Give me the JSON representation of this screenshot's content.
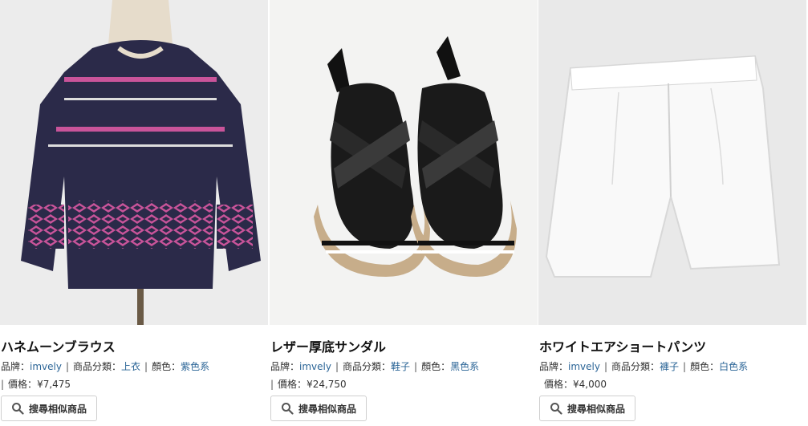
{
  "labels": {
    "brand": "品牌：",
    "category": "商品分類：",
    "color": "顏色：",
    "price": "價格："
  },
  "products": [
    {
      "name": "ハネムーンブラウス",
      "brand": "imvely",
      "category": "上衣",
      "color": "紫色系",
      "price": "¥7,475",
      "button": "搜尋相似商品"
    },
    {
      "name": "レザー厚底サンダル",
      "brand": "imvely",
      "category": "鞋子",
      "color": "黑色系",
      "price": "¥24,750",
      "button": "搜尋相似商品"
    },
    {
      "name": "ホワイトエアショートパンツ",
      "brand": "imvely",
      "category": "褲子",
      "color": "白色系",
      "price": "¥4,000",
      "button": "搜尋相似商品"
    }
  ],
  "icons": {
    "search": "search-icon"
  }
}
